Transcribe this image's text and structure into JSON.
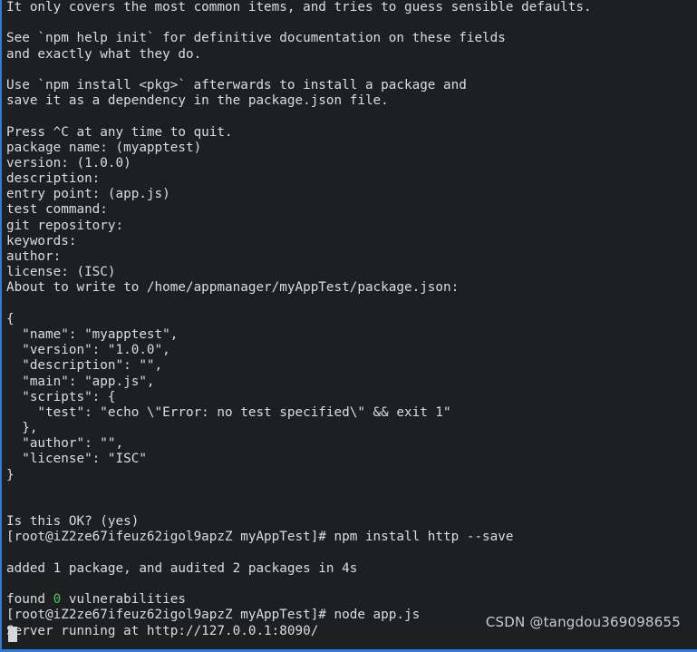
{
  "window": {
    "type": "terminal-emulator",
    "border_color": "#2a7fd4",
    "background_color": "#1d1f21",
    "foreground_color": "#d9dee6",
    "green_color": "#4fc94f",
    "cursor_color": "#d5d8dc"
  },
  "watermark": {
    "text": "CSDN @tangdou369098655"
  },
  "terminal": {
    "prompt": "[root@iZ2ze67ifeuz62igol9apzZ myAppTest]#",
    "hostname": "iZ2ze67ifeuz62igol9apzZ",
    "user": "root",
    "cwd": "myAppTest",
    "server_url": "http://127.0.0.1:8090/",
    "lines": [
      "It only covers the most common items, and tries to guess sensible defaults.",
      "",
      "See `npm help init` for definitive documentation on these fields",
      "and exactly what they do.",
      "",
      "Use `npm install <pkg>` afterwards to install a package and",
      "save it as a dependency in the package.json file.",
      "",
      "Press ^C at any time to quit.",
      "package name: (myapptest)",
      "version: (1.0.0)",
      "description:",
      "entry point: (app.js)",
      "test command:",
      "git repository:",
      "keywords:",
      "author:",
      "license: (ISC)",
      "About to write to /home/appmanager/myAppTest/package.json:",
      "",
      "{",
      "  \"name\": \"myapptest\",",
      "  \"version\": \"1.0.0\",",
      "  \"description\": \"\",",
      "  \"main\": \"app.js\",",
      "  \"scripts\": {",
      "    \"test\": \"echo \\\"Error: no test specified\\\" && exit 1\"",
      "  },",
      "  \"author\": \"\",",
      "  \"license\": \"ISC\"",
      "}",
      "",
      "",
      "Is this OK? (yes)",
      "[root@iZ2ze67ifeuz62igol9apzZ myAppTest]# npm install http --save",
      "",
      "added 1 package, and audited 2 packages in 4s",
      "",
      "FOUND_VULN_LINE",
      "[root@iZ2ze67ifeuz62igol9apzZ myAppTest]# node app.js",
      "Server running at http://127.0.0.1:8090/"
    ],
    "found_vulnerabilities": {
      "prefix": "found ",
      "count": "0",
      "suffix": " vulnerabilities"
    }
  }
}
